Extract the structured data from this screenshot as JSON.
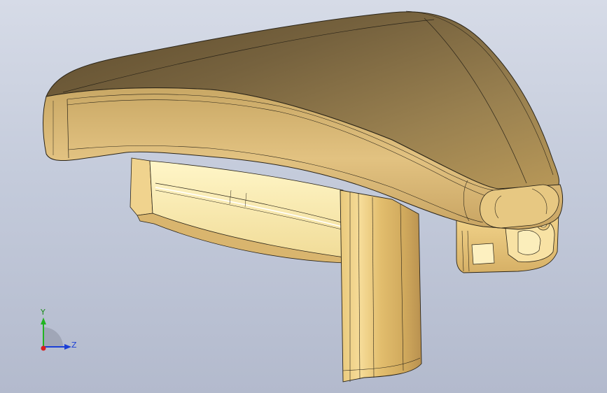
{
  "viewport": {
    "background_top": "#d6dbe7",
    "background_bottom": "#b3bacd"
  },
  "model": {
    "body_color": "#d9b56e",
    "shadow_color": "#6e5a38",
    "inner_color": "#f7eab5",
    "edge_color": "#2a2418"
  },
  "triad": {
    "y_label": "Y",
    "z_label": "Z",
    "y_color": "#22b422",
    "z_color": "#1b3fd6",
    "x_color": "#d81e1e"
  }
}
